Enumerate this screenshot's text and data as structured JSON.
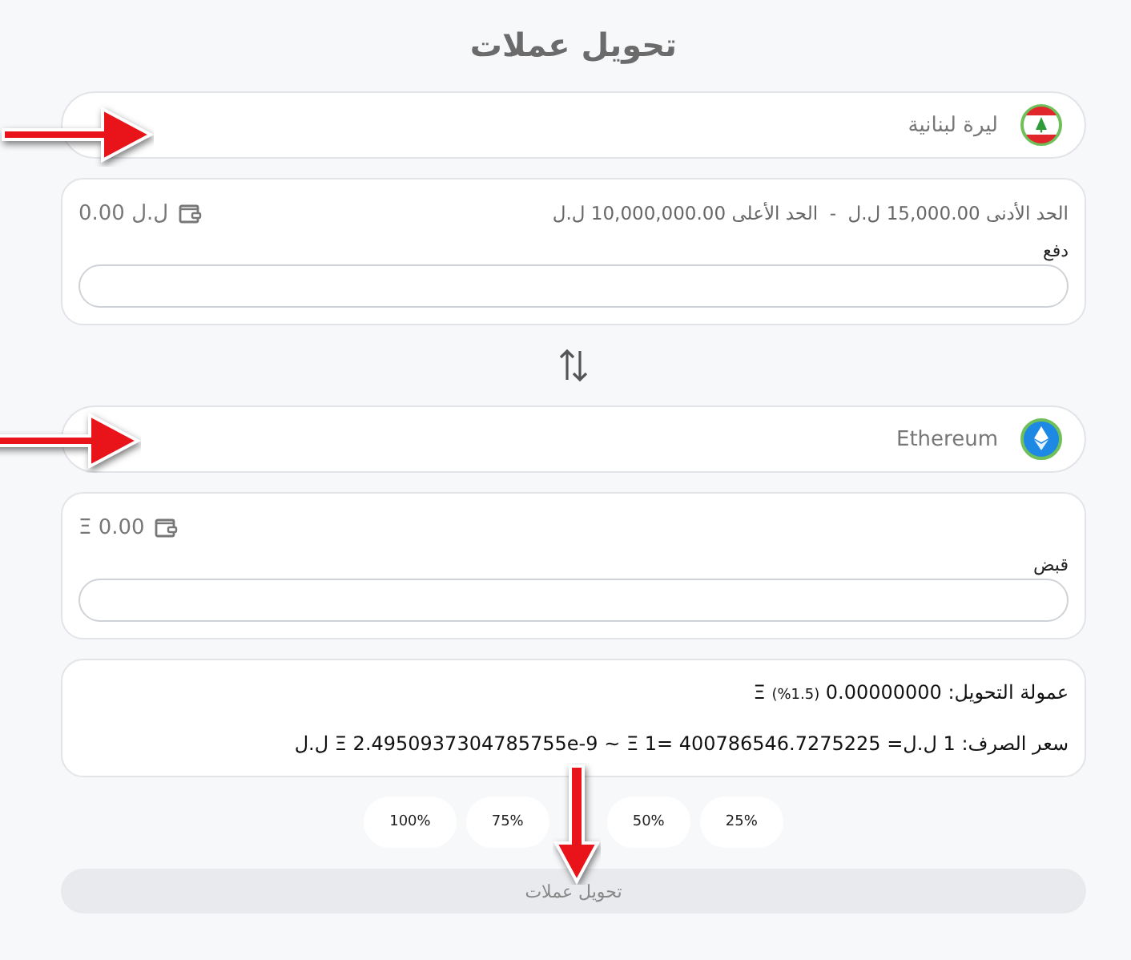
{
  "title": "تحويل عملات",
  "from": {
    "currency": "ليرة لبنانية",
    "kind": "lebanon",
    "limits": "الحد الأدنى 15,000.00 ل.ل  -  الحد الأعلى 10,000,000.00 ل.ل",
    "balance": "0.00 ل.ل",
    "field_label": "دفع"
  },
  "to": {
    "currency": "Ethereum",
    "kind": "ethereum",
    "balance": "Ξ 0.00",
    "field_label": "قبض"
  },
  "fee": {
    "label": "عمولة التحويل:",
    "amount": "0.00000000",
    "percent": "(%1.5)",
    "symbol": "Ξ"
  },
  "rate": {
    "label": "سعر الصرف:",
    "value": "1 ل.ل= Ξ 2.4950937304785755e-9 ~ Ξ 1= 400786546.7275225 ل.ل"
  },
  "percent_buttons": [
    "25%",
    "50%",
    "75%",
    "100%"
  ],
  "convert_button": {
    "label": "تحويل عملات",
    "disabled": true
  },
  "annotations": [
    {
      "kind": "right"
    },
    {
      "kind": "right"
    },
    {
      "kind": "down"
    }
  ]
}
